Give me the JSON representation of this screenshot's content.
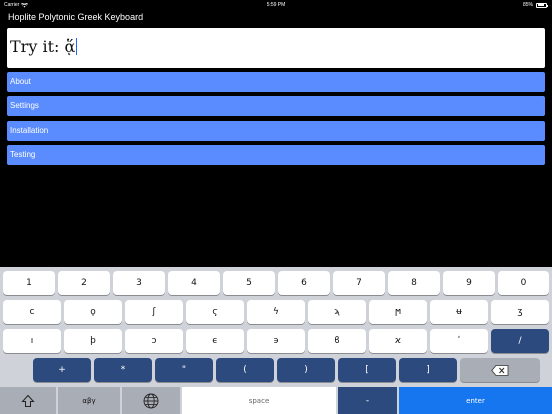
{
  "status_bar": {
    "carrier": "Carrier",
    "time": "5:59 PM",
    "battery_percent": "85%",
    "battery_level": 0.85
  },
  "app": {
    "title": "Hoplite Polytonic Greek Keyboard"
  },
  "try_field": {
    "text": "Try it: ᾅ"
  },
  "menu": [
    {
      "label": "About"
    },
    {
      "label": "Settings"
    },
    {
      "label": "Installation"
    },
    {
      "label": "Testing"
    }
  ],
  "keyboard": {
    "row1": [
      "1",
      "2",
      "3",
      "4",
      "5",
      "6",
      "7",
      "8",
      "9",
      "0"
    ],
    "row2": [
      "ϲ",
      "ϙ",
      "ʃ",
      "ϛ",
      "ϟ",
      "ϡ",
      "ϻ",
      "ʉ",
      "ʒ"
    ],
    "row3": [
      "ı",
      "ϸ",
      "ͻ",
      "ϵ",
      "϶",
      "ϐ",
      "ϰ",
      "ʹ",
      "/"
    ],
    "row4": [
      "+",
      "*",
      "\"",
      "(",
      ")",
      "[",
      "]"
    ],
    "row5": {
      "shift": "shift-icon",
      "mode_label": "αβγ",
      "globe": "globe-icon",
      "space_label": "space",
      "minus_label": "-",
      "enter_label": "enter"
    }
  },
  "colors": {
    "menu": "#5b8cff",
    "dark_key": "#2c4a7e",
    "enter": "#1576f0",
    "keyboard_bg": "#cfd2d8"
  }
}
